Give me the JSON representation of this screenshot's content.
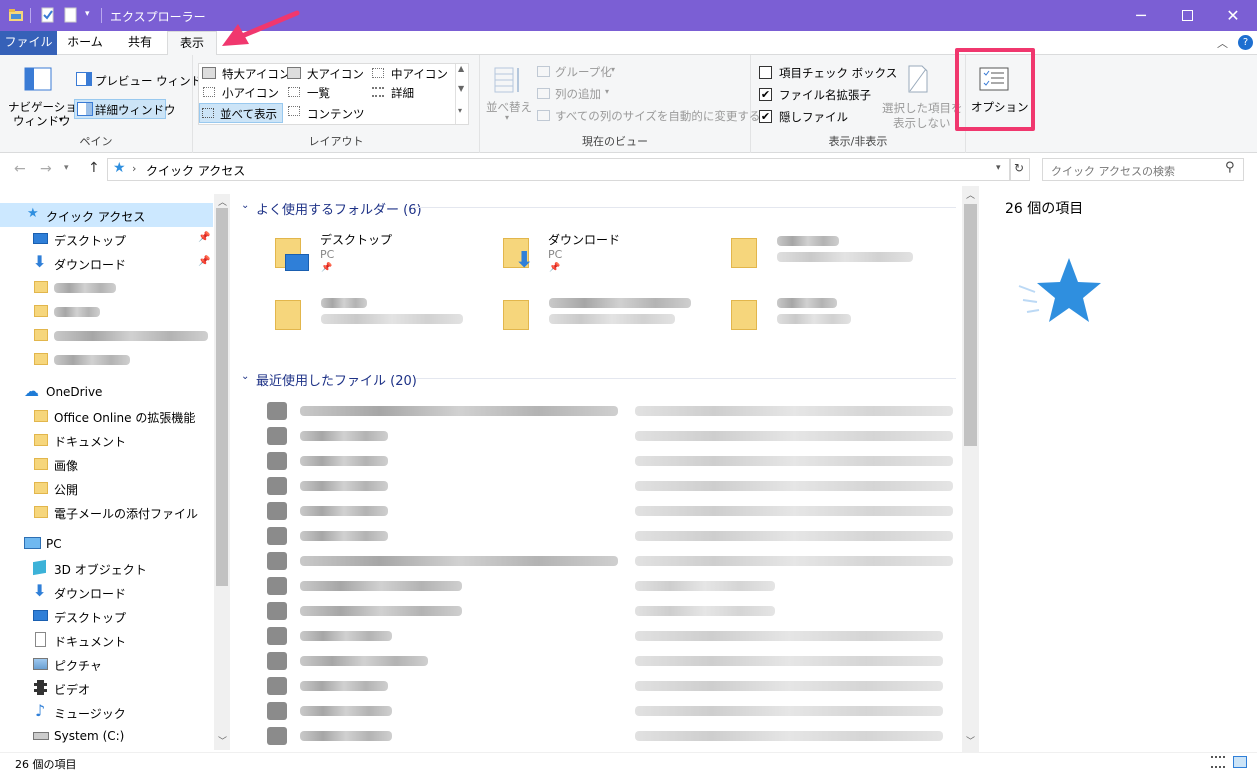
{
  "window": {
    "title": "エクスプローラー"
  },
  "tabs": {
    "file": "ファイル",
    "home": "ホーム",
    "share": "共有",
    "view": "表示"
  },
  "ribbon": {
    "pane": {
      "nav_pane": "ナビゲーション",
      "nav_pane2": "ウィンドウ",
      "preview": "プレビュー ウィンドウ",
      "details": "詳細ウィンドウ",
      "label": "ペイン"
    },
    "layout": {
      "xl_icons": "特大アイコン",
      "l_icons": "大アイコン",
      "m_icons": "中アイコン",
      "s_icons": "小アイコン",
      "list": "一覧",
      "details": "詳細",
      "tiles": "並べて表示",
      "content": "コンテンツ",
      "label": "レイアウト"
    },
    "current_view": {
      "sort": "並べ替え",
      "group": "グループ化",
      "add_col": "列の追加",
      "autosize": "すべての列のサイズを自動的に変更する",
      "label": "現在のビュー"
    },
    "show_hide": {
      "item_checkbox": "項目チェック ボックス",
      "ext": "ファイル名拡張子",
      "hidden": "隠しファイル",
      "hide_sel1": "選択した項目を",
      "hide_sel2": "表示しない",
      "label": "表示/非表示",
      "item_checkbox_checked": false,
      "ext_checked": true,
      "hidden_checked": true
    },
    "options": {
      "label": "オプション"
    }
  },
  "address": {
    "path": "クイック アクセス",
    "search_placeholder": "クイック アクセスの検索"
  },
  "nav": {
    "quick_access": "クイック アクセス",
    "desktop": "デスクトップ",
    "downloads": "ダウンロード",
    "onedrive": "OneDrive",
    "od_items": [
      "Office Online の拡張機能",
      "ドキュメント",
      "画像",
      "公開",
      "電子メールの添付ファイル"
    ],
    "pc": "PC",
    "pc_items": [
      "3D オブジェクト",
      "ダウンロード",
      "デスクトップ",
      "ドキュメント",
      "ピクチャ",
      "ビデオ",
      "ミュージック",
      "System (C:)"
    ]
  },
  "content": {
    "frequent_header": "よく使用するフォルダー (6)",
    "recent_header": "最近使用したファイル (20)",
    "folders": [
      {
        "name": "デスクトップ",
        "sub": "PC"
      },
      {
        "name": "ダウンロード",
        "sub": "PC"
      }
    ]
  },
  "preview": {
    "count": "26 個の項目"
  },
  "status": {
    "count": "26 個の項目"
  },
  "colors": {
    "titlebar": "#7b5fd4",
    "file_tab": "#3661b8",
    "highlight": "#f0376e",
    "star": "#2f8fdf"
  }
}
